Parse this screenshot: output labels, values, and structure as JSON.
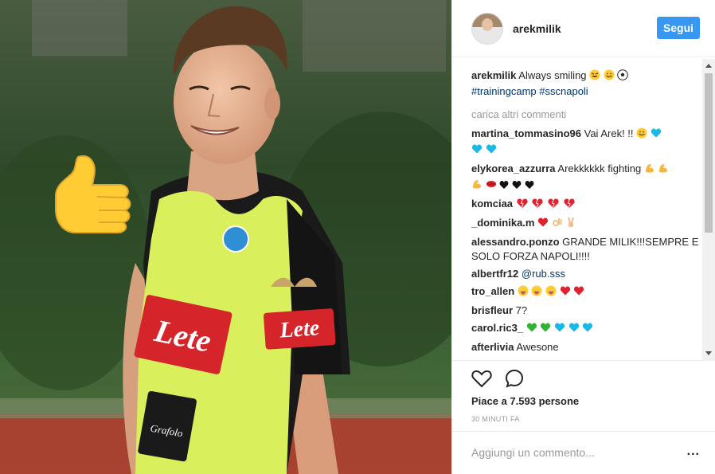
{
  "post": {
    "username": "arekmilik",
    "follow_label": "Segui",
    "caption_text": "Always smiling",
    "hashtags": "#trainingcamp #sscnapoli",
    "load_more": "carica altri commenti",
    "likes_text": "Piace a 7.593 persone",
    "time_text": "30 MINUTI FA",
    "add_comment_placeholder": "Aggiungi un commento...",
    "more_label": "..."
  },
  "photo": {
    "bib_sponsor": "Lete",
    "shirt_sponsor": "Lete",
    "bib_brand": "Grafolo"
  },
  "comments": [
    {
      "user": "martina_tommasino96",
      "text": "Vai Arek! !!"
    },
    {
      "user": "elykorea_azzurra",
      "text": "Arekkkkkk fighting"
    },
    {
      "user": "komciaa",
      "text": ""
    },
    {
      "user": "_dominika.m",
      "text": ""
    },
    {
      "user": "alessandro.ponzo",
      "text": "GRANDE MILIK!!!SEMPRE E SOLO FORZA NAPOLI!!!!"
    },
    {
      "user": "albertfr12",
      "text": "@rub.sss"
    },
    {
      "user": "tro_allen",
      "text": ""
    },
    {
      "user": "brisfleur",
      "text": "7?"
    },
    {
      "user": "carol.ric3_",
      "text": ""
    },
    {
      "user": "afterlivia",
      "text": "Awesone"
    }
  ],
  "colors": {
    "accent": "#3897f0",
    "link": "#003569",
    "muted": "#999999",
    "bib": "#d8ef54",
    "sponsor_red": "#d81f26"
  }
}
